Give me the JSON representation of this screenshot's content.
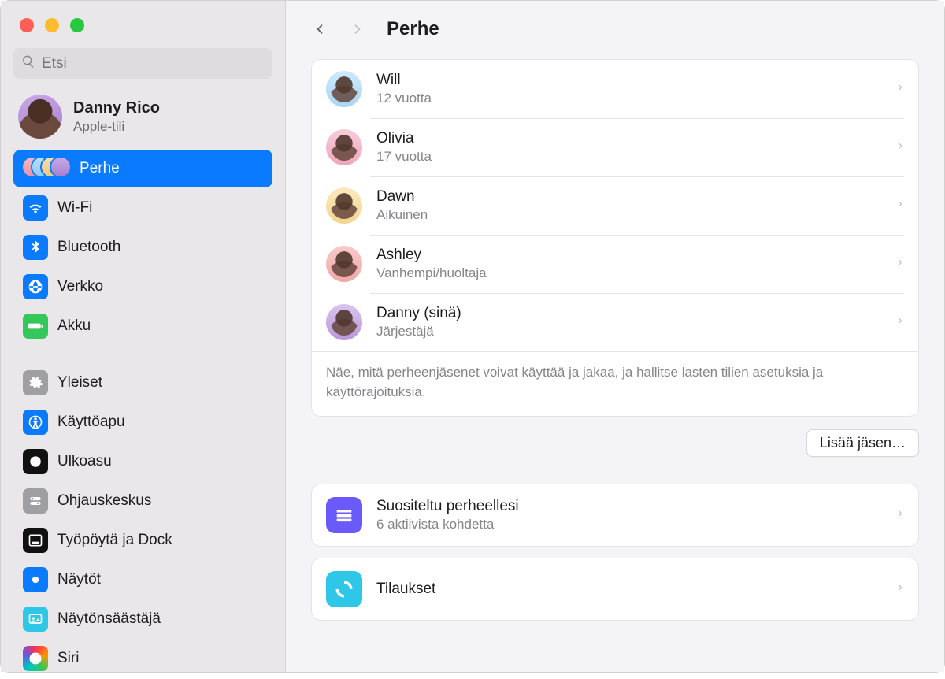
{
  "search": {
    "placeholder": "Etsi"
  },
  "account": {
    "name": "Danny Rico",
    "subtitle": "Apple-tili"
  },
  "sidebar": {
    "family_label": "Perhe",
    "items": [
      {
        "label": "Wi-Fi",
        "color": "#0a7aff",
        "icon": "wifi"
      },
      {
        "label": "Bluetooth",
        "color": "#0a7aff",
        "icon": "bluetooth"
      },
      {
        "label": "Verkko",
        "color": "#0a7aff",
        "icon": "globe"
      },
      {
        "label": "Akku",
        "color": "#34c759",
        "icon": "battery"
      }
    ],
    "items2": [
      {
        "label": "Yleiset",
        "color": "#9e9ea3",
        "icon": "gear"
      },
      {
        "label": "Käyttöapu",
        "color": "#0a7aff",
        "icon": "accessibility"
      },
      {
        "label": "Ulkoasu",
        "color": "#111",
        "icon": "appearance"
      },
      {
        "label": "Ohjauskeskus",
        "color": "#9e9ea3",
        "icon": "controlcenter"
      },
      {
        "label": "Työpöytä ja Dock",
        "color": "#111",
        "icon": "dock"
      },
      {
        "label": "Näytöt",
        "color": "#0a7aff",
        "icon": "displays"
      },
      {
        "label": "Näytönsäästäjä",
        "color": "#2fc7e8",
        "icon": "screensaver"
      },
      {
        "label": "Siri",
        "color": "linear",
        "icon": "siri"
      }
    ]
  },
  "header": {
    "title": "Perhe"
  },
  "members": [
    {
      "name": "Will",
      "sub": "12 vuotta",
      "avatar": "blue"
    },
    {
      "name": "Olivia",
      "sub": "17 vuotta",
      "avatar": "pink"
    },
    {
      "name": "Dawn",
      "sub": "Aikuinen",
      "avatar": "yellow"
    },
    {
      "name": "Ashley",
      "sub": "Vanhempi/huoltaja",
      "avatar": "salmon"
    },
    {
      "name": "Danny (sinä)",
      "sub": "Järjestäjä",
      "avatar": "purple"
    }
  ],
  "members_footer": "Näe, mitä perheenjäsenet voivat käyttää ja jakaa, ja hallitse lasten tilien asetuksia ja käyttörajoituksia.",
  "add_member_label": "Lisää jäsen…",
  "recommended": {
    "title": "Suositeltu perheellesi",
    "sub": "6 aktiivista kohdetta",
    "color": "#6a5af9"
  },
  "subscriptions": {
    "title": "Tilaukset",
    "color": "#2fc7e8"
  }
}
